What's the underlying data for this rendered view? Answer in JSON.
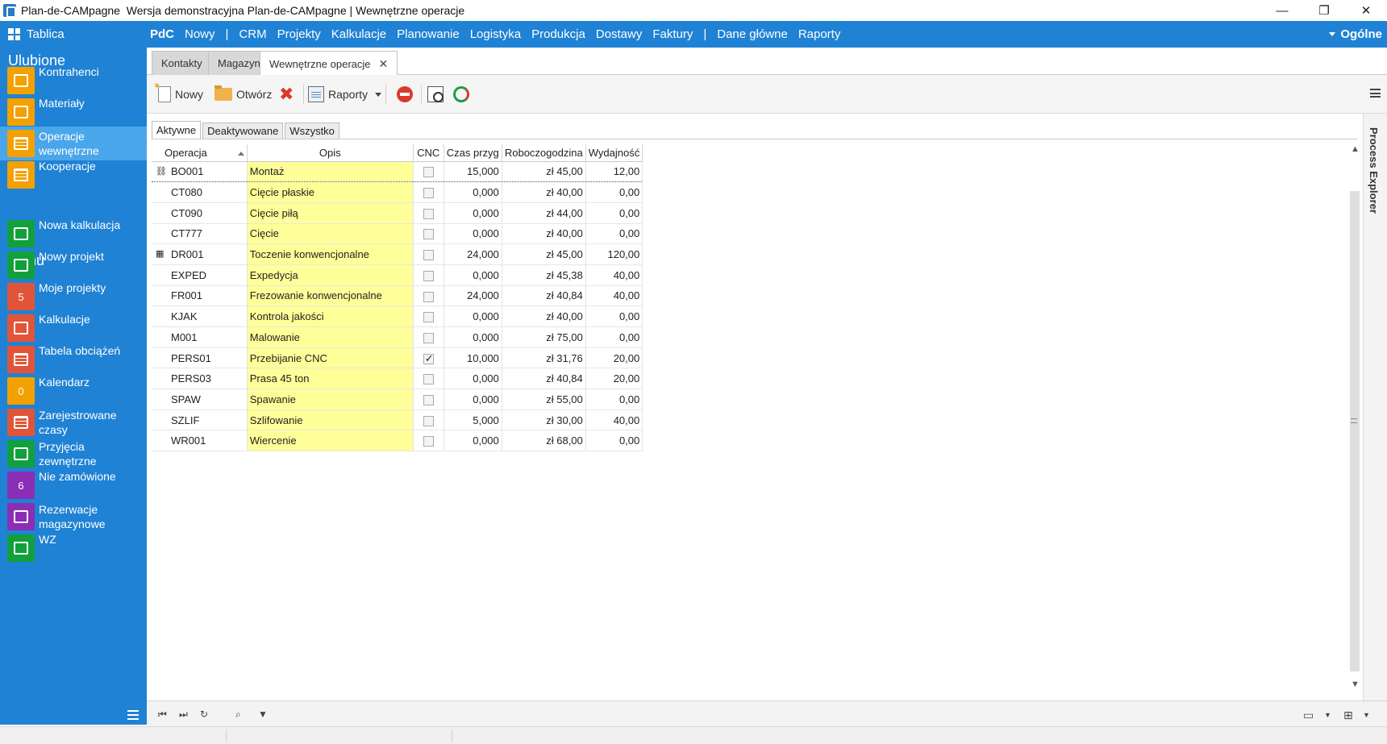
{
  "window": {
    "app_name": "Plan-de-CAMpagne",
    "title": "Wersja demonstracyjna Plan-de-CAMpagne | Wewnętrzne operacje",
    "controls": {
      "minimize": "—",
      "restore": "❐",
      "close": "✕"
    }
  },
  "topbar": {
    "tablica": "Tablica",
    "brand": "PdC",
    "nav_group1": [
      "Nowy"
    ],
    "nav_group2": [
      "CRM",
      "Projekty",
      "Kalkulacje",
      "Planowanie",
      "Logistyka",
      "Produkcja",
      "Dostawy",
      "Faktury"
    ],
    "nav_group3": [
      "Dane główne",
      "Raporty"
    ],
    "separator": "|",
    "right_menu": "Ogólne"
  },
  "sidebar": {
    "favorites_title": "Ulubione",
    "favorites": [
      {
        "label": "Kontrahenci",
        "icon": "people-icon",
        "color": "#f2a100"
      },
      {
        "label": "Materiały",
        "icon": "materials-icon",
        "color": "#f2a100"
      },
      {
        "label": "Operacje wewnętrzne",
        "icon": "table-icon",
        "color": "#f2a100",
        "active": true
      },
      {
        "label": "Kooperacje",
        "icon": "table-icon",
        "color": "#f2a100"
      }
    ],
    "menu_title": "Menu",
    "menu": [
      {
        "label": "Nowa kalkulacja",
        "icon": "new-doc-icon",
        "color": "#12a03c"
      },
      {
        "label": "Nowy projekt",
        "icon": "new-doc-icon",
        "color": "#12a03c"
      },
      {
        "label": "Moje projekty",
        "badge": "5",
        "color": "#e0553a"
      },
      {
        "label": "Kalkulacje",
        "icon": "calculator-icon",
        "color": "#e0553a"
      },
      {
        "label": "Tabela obciążeń",
        "icon": "table-icon",
        "color": "#e0553a"
      },
      {
        "label": "Kalendarz",
        "badge": "0",
        "color": "#f2a100"
      },
      {
        "label": "Zarejestrowane czasy",
        "icon": "table-icon",
        "color": "#e0553a"
      },
      {
        "label": "Przyjęcia zewnętrzne",
        "icon": "receipt-icon",
        "color": "#12a03c"
      },
      {
        "label": "Nie zamówione",
        "badge": "6",
        "color": "#8a2eb6"
      },
      {
        "label": "Rezerwacje magazynowe",
        "icon": "reservation-icon",
        "color": "#8a2eb6"
      },
      {
        "label": "WZ",
        "icon": "delivery-note-icon",
        "color": "#12a03c"
      }
    ]
  },
  "doc_tabs": [
    {
      "label": "Kontakty"
    },
    {
      "label": "Magazyn"
    },
    {
      "label": "Wewnętrzne operacje",
      "active": true,
      "close": "✕"
    }
  ],
  "toolbar": {
    "new_label": "Nowy",
    "open_label": "Otwórz",
    "delete_symbol": "✖",
    "reports_label": "Raporty"
  },
  "filter_tabs": [
    "Aktywne",
    "Deaktywowane",
    "Wszystko"
  ],
  "grid": {
    "columns": [
      "Operacja",
      "Opis",
      "CNC",
      "Czas przyg",
      "Roboczogodzina",
      "Wydajność"
    ],
    "rows": [
      {
        "op": "BO001",
        "desc": "Montaż",
        "cnc": false,
        "czas": "15,000",
        "rate": "zł 45,00",
        "wyd": "12,00",
        "marker": "⛓",
        "selected": true
      },
      {
        "op": "CT080",
        "desc": "Cięcie płaskie",
        "cnc": false,
        "czas": "0,000",
        "rate": "zł 40,00",
        "wyd": "0,00"
      },
      {
        "op": "CT090",
        "desc": "Cięcie piłą",
        "cnc": false,
        "czas": "0,000",
        "rate": "zł 44,00",
        "wyd": "0,00"
      },
      {
        "op": "CT777",
        "desc": "Cięcie",
        "cnc": false,
        "czas": "0,000",
        "rate": "zł 40,00",
        "wyd": "0,00"
      },
      {
        "op": "DR001",
        "desc": "Toczenie konwencjonalne",
        "cnc": false,
        "czas": "24,000",
        "rate": "zł 45,00",
        "wyd": "120,00",
        "marker": "▦"
      },
      {
        "op": "EXPED",
        "desc": "Expedycja",
        "cnc": false,
        "czas": "0,000",
        "rate": "zł 45,38",
        "wyd": "40,00"
      },
      {
        "op": "FR001",
        "desc": "Frezowanie konwencjonalne",
        "cnc": false,
        "czas": "24,000",
        "rate": "zł 40,84",
        "wyd": "40,00"
      },
      {
        "op": "KJAK",
        "desc": "Kontrola jakości",
        "cnc": false,
        "czas": "0,000",
        "rate": "zł 40,00",
        "wyd": "0,00"
      },
      {
        "op": "M001",
        "desc": "Malowanie",
        "cnc": false,
        "czas": "0,000",
        "rate": "zł 75,00",
        "wyd": "0,00"
      },
      {
        "op": "PERS01",
        "desc": "Przebijanie CNC",
        "cnc": true,
        "czas": "10,000",
        "rate": "zł 31,76",
        "wyd": "20,00"
      },
      {
        "op": "PERS03",
        "desc": "Prasa 45 ton",
        "cnc": false,
        "czas": "0,000",
        "rate": "zł 40,84",
        "wyd": "20,00"
      },
      {
        "op": "SPAW",
        "desc": "Spawanie",
        "cnc": false,
        "czas": "0,000",
        "rate": "zł 55,00",
        "wyd": "0,00"
      },
      {
        "op": "SZLIF",
        "desc": "Szlifowanie",
        "cnc": false,
        "czas": "5,000",
        "rate": "zł 30,00",
        "wyd": "40,00"
      },
      {
        "op": "WR001",
        "desc": "Wiercenie",
        "cnc": false,
        "czas": "0,000",
        "rate": "zł 68,00",
        "wyd": "0,00"
      }
    ]
  },
  "right_panel": {
    "label": "Process Explorer"
  },
  "bottom_nav": {
    "first": "⏮",
    "last": "⏭",
    "refresh": "↻",
    "search": "⌕",
    "filter": "▼"
  },
  "colors": {
    "accent": "#1f82d4",
    "sidebar_active": "#4aa6ea",
    "description_cell": "#ffff99"
  }
}
